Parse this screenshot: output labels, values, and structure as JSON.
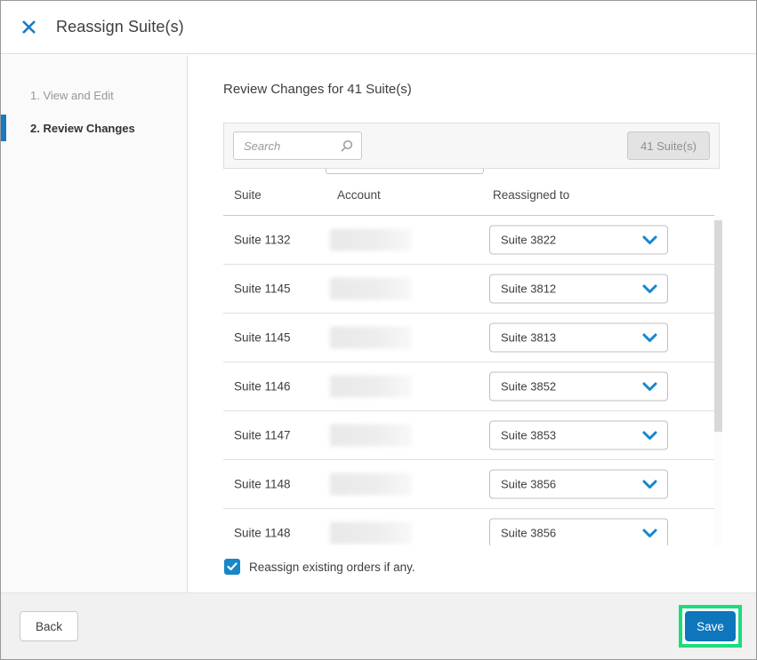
{
  "header": {
    "title": "Reassign Suite(s)"
  },
  "sidebar": {
    "steps": [
      {
        "label": "1. View and Edit",
        "active": false
      },
      {
        "label": "2. Review Changes",
        "active": true
      }
    ]
  },
  "main": {
    "title": "Review Changes for 41 Suite(s)",
    "toolbar": {
      "search_placeholder": "Search",
      "count_button_label": "41 Suite(s)"
    },
    "table": {
      "columns": [
        "Suite",
        "Account",
        "Reassigned to"
      ],
      "rows": [
        {
          "suite": "Suite 1132",
          "account": "(redacted)",
          "reassigned_to": "Suite 3822"
        },
        {
          "suite": "Suite 1145",
          "account": "(redacted)",
          "reassigned_to": "Suite 3812"
        },
        {
          "suite": "Suite 1145",
          "account": "(redacted)",
          "reassigned_to": "Suite 3813"
        },
        {
          "suite": "Suite 1146",
          "account": "(redacted)",
          "reassigned_to": "Suite 3852"
        },
        {
          "suite": "Suite 1147",
          "account": "(redacted)",
          "reassigned_to": "Suite 3853"
        },
        {
          "suite": "Suite 1148",
          "account": "(redacted)",
          "reassigned_to": "Suite 3856"
        },
        {
          "suite": "Suite 1148",
          "account": "(redacted)",
          "reassigned_to": "Suite 3856"
        }
      ]
    },
    "checkbox": {
      "checked": true,
      "label": "Reassign existing orders if any."
    }
  },
  "footer": {
    "back_label": "Back",
    "save_label": "Save"
  },
  "colors": {
    "accent_blue": "#0d76bc",
    "icon_blue": "#1787c9",
    "highlight_green": "#1bdd7d"
  }
}
